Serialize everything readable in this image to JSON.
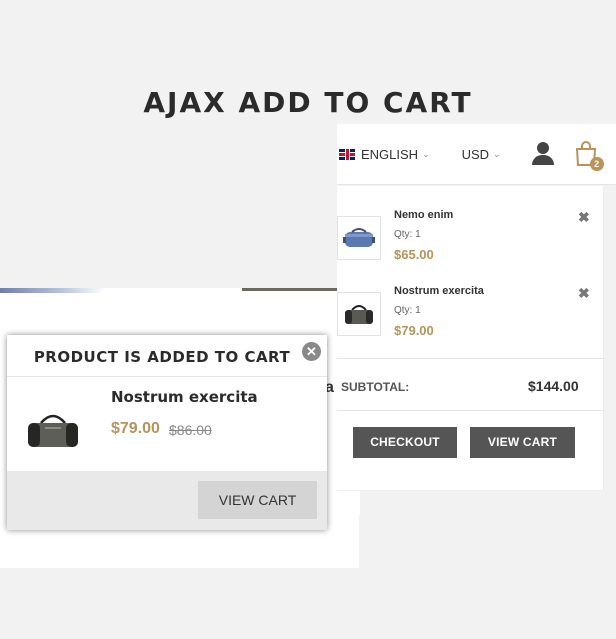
{
  "headline": "AJAX ADD TO CART",
  "header": {
    "language": "ENGLISH",
    "currency": "USD",
    "cart_count": "2",
    "icons": [
      "uk-flag-icon",
      "chevron-down-icon",
      "user-icon",
      "shopping-bag-icon"
    ]
  },
  "mini_cart": {
    "items": [
      {
        "name": "Nemo enim",
        "qty": "Qty: 1",
        "price": "$65.00",
        "remove": "✖",
        "thumb": "blue-bag-icon"
      },
      {
        "name": "Nostrum exercita",
        "qty": "Qty: 1",
        "price": "$79.00",
        "remove": "✖",
        "thumb": "gray-duffel-bag-icon"
      }
    ],
    "subtotal_label": "SUBTOTAL:",
    "subtotal_value": "$144.00",
    "checkout_label": "CHECKOUT",
    "view_cart_label": "VIEW CART"
  },
  "background": {
    "partial_letter": "a"
  },
  "popup": {
    "title": "PRODUCT IS ADDED TO CART",
    "close": "✕",
    "product_name": "Nostrum exercita",
    "price": "$79.00",
    "old_price": "$86.00",
    "view_cart_label": "VIEW CART"
  },
  "colors": {
    "accent_gold": "#b8935a",
    "dark_button": "#555555",
    "page_bg": "#f2f2f2"
  }
}
